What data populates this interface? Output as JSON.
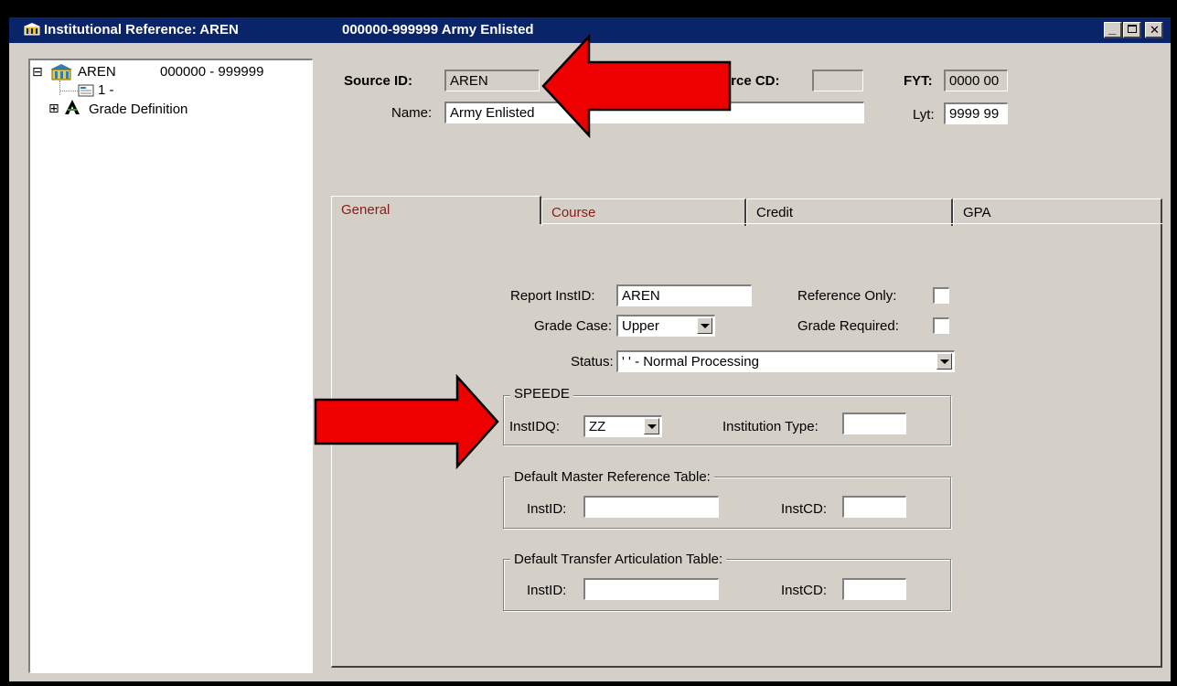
{
  "window": {
    "title_left": "Institutional Reference: AREN",
    "title_right": "000000-999999 Army Enlisted",
    "minimize_glyph": "_",
    "maximize_glyph": "□",
    "close_glyph": "✕"
  },
  "tree": {
    "root_toggle": "⊟",
    "root_label": "AREN",
    "root_range": "000000 - 999999",
    "child1_label": "1 -",
    "child2_toggle": "⊞",
    "child2_label": "Grade Definition"
  },
  "header": {
    "source_id_label": "Source ID:",
    "source_id_value": "AREN",
    "source_cd_label": "urce CD:",
    "source_cd_value": "",
    "fyt_label": "FYT:",
    "fyt_value": "0000 00",
    "name_label": "Name:",
    "name_value": "Army Enlisted",
    "lyt_label": "Lyt:",
    "lyt_value": "9999 99"
  },
  "tabs": [
    {
      "label": "General"
    },
    {
      "label": "Course"
    },
    {
      "label": "Credit"
    },
    {
      "label": "GPA"
    }
  ],
  "general": {
    "report_instid_label": "Report InstID:",
    "report_instid_value": "AREN",
    "reference_only_label": "Reference Only:",
    "grade_case_label": "Grade Case:",
    "grade_case_value": "Upper",
    "grade_required_label": "Grade Required:",
    "status_label": "Status:",
    "status_value": "' ' - Normal Processing",
    "speede": {
      "title": "SPEEDE",
      "instidq_label": "InstIDQ:",
      "instidq_value": "ZZ",
      "institution_type_label": "Institution Type:",
      "institution_type_value": ""
    },
    "master_ref": {
      "title": "Default Master Reference Table:",
      "instid_label": "InstID:",
      "instid_value": "",
      "instcd_label": "InstCD:",
      "instcd_value": ""
    },
    "transfer_art": {
      "title": "Default Transfer Articulation Table:",
      "instid_label": "InstID:",
      "instid_value": "",
      "instcd_label": "InstCD:",
      "instcd_value": ""
    }
  },
  "colors": {
    "titlebar": "#0a246a",
    "tab_text_active": "#8b1a1a",
    "arrow": "#ee0000"
  }
}
